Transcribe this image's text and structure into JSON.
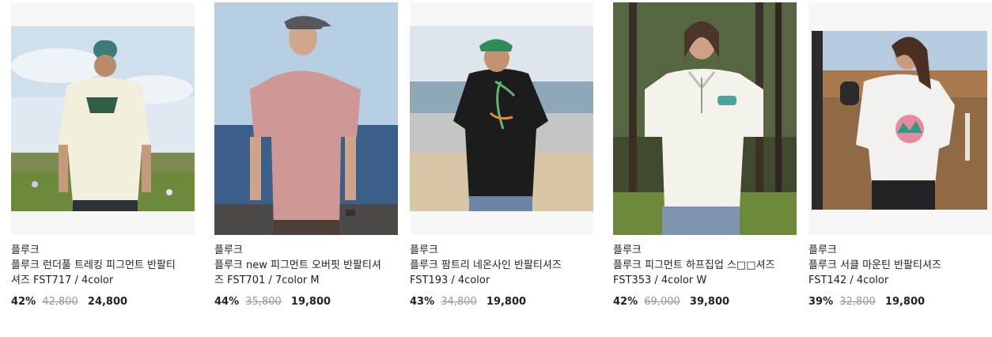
{
  "products": [
    {
      "brand": "플루크",
      "title": "플루크 런더풀 트레킹 피그먼트 반팔티셔즈 FST717 / 4color",
      "discount": "42%",
      "original_price": "42,800",
      "sale_price": "24,800",
      "image": "man-cream-tshirt-back-sky"
    },
    {
      "brand": "플루크",
      "title": "플루크 new 피그먼트 오버핏 반팔티셔즈 FST701 / 7color M",
      "discount": "44%",
      "original_price": "35,800",
      "sale_price": "19,800",
      "image": "model-pink-tshirt-cap-sea"
    },
    {
      "brand": "플루크",
      "title": "플루크 팜트리 네온사인 반팔티셔즈 FST193 / 4color",
      "discount": "43%",
      "original_price": "34,800",
      "sale_price": "19,800",
      "image": "man-black-tshirt-palm-print"
    },
    {
      "brand": "플루크",
      "title": "플루크 피그먼트 하프집업 스□□셔즈 FST353 / 4color W",
      "discount": "42%",
      "original_price": "69,000",
      "sale_price": "39,800",
      "image": "woman-white-halfzip-forest"
    },
    {
      "brand": "플루크",
      "title": "플루크 서클 마운틴 반팔티셔즈 FST142 / 4color",
      "discount": "39%",
      "original_price": "32,800",
      "sale_price": "19,800",
      "image": "woman-white-adventure-tshirt"
    }
  ]
}
